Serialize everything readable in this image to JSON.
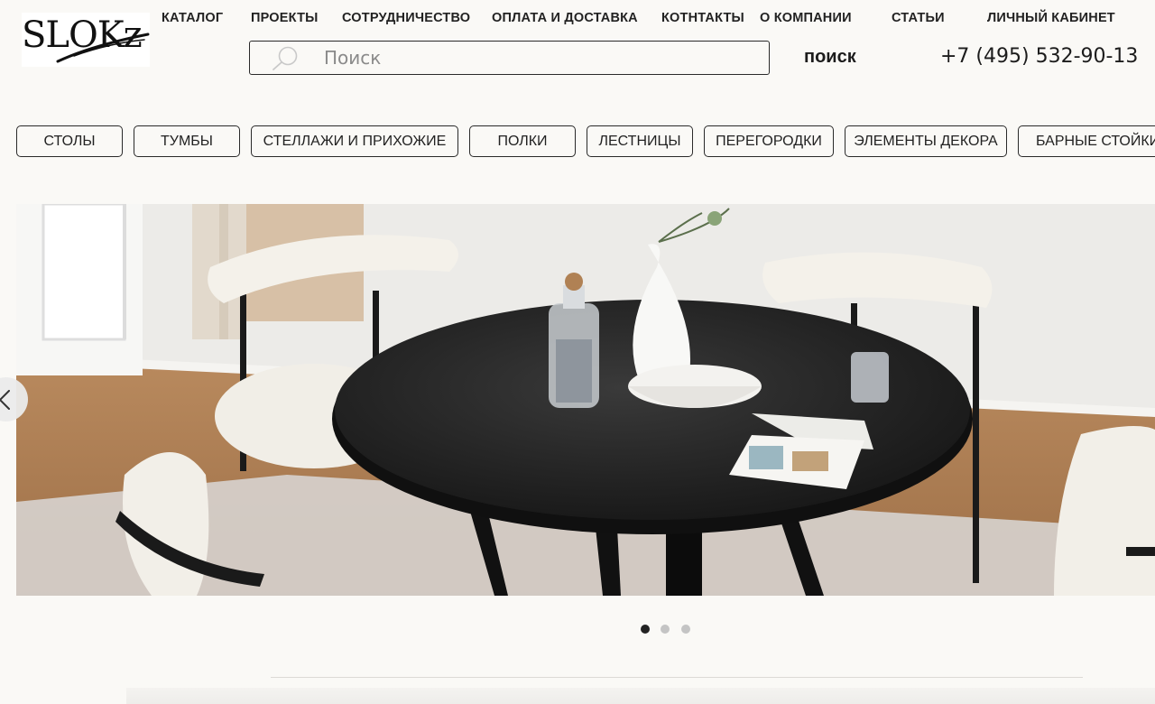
{
  "header": {
    "logo_text": "SLOKz",
    "nav": [
      "КАТАЛОГ",
      "ПРОЕКТЫ",
      "СОТРУДНИЧЕСТВО",
      "ОПЛАТА И ДОСТАВКА",
      "КОТНТАКТЫ",
      "О КОМПАНИИ",
      "СТАТЬИ",
      "ЛИЧНЫЙ КАБИНЕТ"
    ],
    "search": {
      "placeholder": "Поиск",
      "value": "",
      "button_label": "поиск"
    },
    "phone": "+7 (495) 532-90-13"
  },
  "categories": [
    "СТОЛЫ",
    "ТУМБЫ",
    "СТЕЛЛАЖИ И ПРИХОЖИЕ",
    "ПОЛКИ",
    "ЛЕСТНИЦЫ",
    "ПЕРЕГОРОДКИ",
    "ЭЛЕМЕНТЫ ДЕКОРА",
    "БАРНЫЕ СТОЙКИ"
  ],
  "slider": {
    "slide_count": 3,
    "active_slide": 1
  },
  "colors": {
    "background": "#faf9f6",
    "text": "#1c1c1c",
    "dot_active": "#222222",
    "dot_inactive": "#c4c4c4"
  },
  "icons": {
    "search": "search-icon",
    "prev": "chevron-left-icon"
  }
}
